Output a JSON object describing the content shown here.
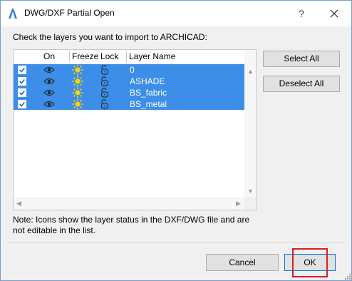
{
  "window": {
    "title": "DWG/DXF Partial Open",
    "help_glyph": "?",
    "app_icon": "archicad-app-icon",
    "close_icon": "close-icon"
  },
  "instruction": "Check the layers you want to import to ARCHICAD:",
  "layer_list": {
    "columns": {
      "on": "On",
      "freeze": "Freeze",
      "lock": "Lock",
      "layer_name": "Layer Name"
    },
    "rows": [
      {
        "checked": true,
        "on_icon": "eye-icon",
        "freeze_icon": "sun-icon",
        "lock_icon": "unlocked-icon",
        "name": "0"
      },
      {
        "checked": true,
        "on_icon": "eye-icon",
        "freeze_icon": "sun-icon",
        "lock_icon": "unlocked-icon",
        "name": "ASHADE"
      },
      {
        "checked": true,
        "on_icon": "eye-icon",
        "freeze_icon": "sun-icon",
        "lock_icon": "unlocked-icon",
        "name": "BS_fabric"
      },
      {
        "checked": true,
        "on_icon": "eye-icon",
        "freeze_icon": "sun-icon",
        "lock_icon": "unlocked-icon",
        "name": "BS_metal"
      }
    ],
    "selection_color": "#3d8ee8"
  },
  "buttons": {
    "select_all": "Select All",
    "deselect_all": "Deselect All",
    "cancel": "Cancel",
    "ok": "OK"
  },
  "note": "Note: Icons show the layer status in the DXF/DWG file and are not editable in the list.",
  "highlight_color": "#d9201d"
}
